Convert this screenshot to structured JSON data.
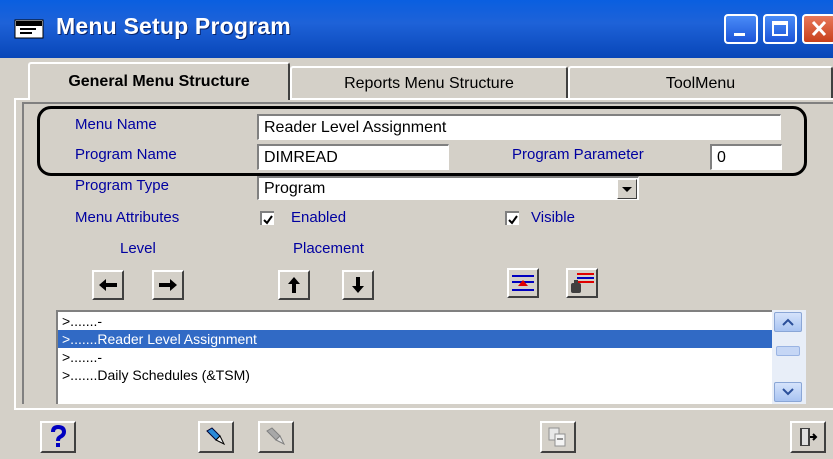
{
  "window": {
    "title": "Menu Setup Program",
    "title_color": "#ffffff",
    "titlebar_color": "#1e62d8"
  },
  "tabs": [
    {
      "label": "General Menu Structure",
      "active": true
    },
    {
      "label": "Reports Menu Structure",
      "active": false
    },
    {
      "label": "ToolMenu",
      "active": false
    }
  ],
  "form": {
    "menu_name_label": "Menu Name",
    "menu_name_value": "Reader Level Assignment",
    "program_name_label": "Program Name",
    "program_name_value": "DIMREAD",
    "program_parameter_label": "Program Parameter",
    "program_parameter_value": "0",
    "program_type_label": "Program Type",
    "program_type_value": "Program",
    "menu_attributes_label": "Menu Attributes",
    "enabled_label": "Enabled",
    "enabled_checked": true,
    "visible_label": "Visible",
    "visible_checked": true
  },
  "arrange": {
    "level_label": "Level",
    "placement_label": "Placement"
  },
  "menu_tree": {
    "items": [
      ">.......-",
      ">.......Reader Level Assignment",
      ">.......-",
      ">.......Daily Schedules (&TSM)"
    ],
    "selected_index": 1
  },
  "icons": {
    "help": "question-mark-icon",
    "save": "save-icon",
    "cancel": "cancel-icon",
    "copy": "copy-icon",
    "exit": "exit-door-icon"
  },
  "colors": {
    "label": "#0000a0",
    "selection": "#316ac5",
    "face": "#d4d0c8"
  }
}
